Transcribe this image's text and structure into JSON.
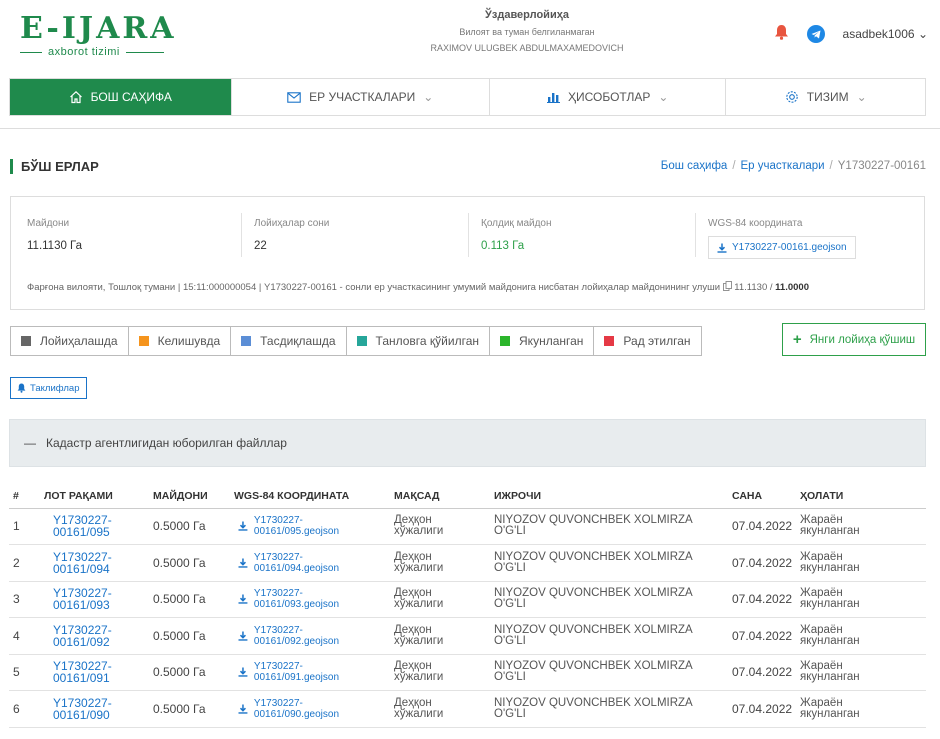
{
  "header": {
    "logo_main": "E-IJARA",
    "logo_sub": "axborot tizimi",
    "org_name": "Ўздаверлойиҳа",
    "org_region": "Вилоят ва туман белгиланмаган",
    "org_person": "RAXIMOV ULUGBEK ABDULMAXAMEDOVICH",
    "username": "asadbek1006"
  },
  "nav": {
    "items": [
      {
        "label": "БОШ САҲИФА",
        "icon": "home-icon"
      },
      {
        "label": "ЕР УЧАСТКАЛАРИ",
        "icon": "envelope-icon"
      },
      {
        "label": "ҲИСОБОТЛАР",
        "icon": "bar-chart-icon"
      },
      {
        "label": "ТИЗИМ",
        "icon": "gear-icon"
      }
    ]
  },
  "page": {
    "title": "БЎШ ЕРЛАР",
    "breadcrumb": [
      "Бош саҳифа",
      "Ер участкалари",
      "Y1730227-00161"
    ]
  },
  "info": {
    "area_label": "Майдони",
    "area_value": "11.1130 Га",
    "projects_label": "Лойиҳалар сони",
    "projects_value": "22",
    "remaining_label": "Қолдиқ майдон",
    "remaining_value": "0.113 Га",
    "coords_label": "WGS-84 координата",
    "coords_file": "Y1730227-00161.geojson",
    "footer_text": "Фарғона вилояти, Тошлоқ тумани | 15:11:000000054 | Y1730227-00161 - сонли ер участкасининг умумий майдонига нисбатан лойиҳалар майдонининг улуши",
    "footer_ratio": "11.1130 /",
    "footer_total": "11.0000"
  },
  "legend": [
    {
      "label": "Лойиҳалашда",
      "color": "#666666"
    },
    {
      "label": "Келишувда",
      "color": "#f5941d"
    },
    {
      "label": "Тасдиқлашда",
      "color": "#5b8ed6"
    },
    {
      "label": "Танловга қўйилган",
      "color": "#26a69a"
    },
    {
      "label": "Якунланган",
      "color": "#2bb52b"
    },
    {
      "label": "Рад этилган",
      "color": "#e53945"
    }
  ],
  "add_button": "Янги лойиҳа қўшиш",
  "suggestions_button": "Таклифлар",
  "panel_title": "Кадастр агентлигидан юборилган файллар",
  "table": {
    "headers": [
      "#",
      "ЛОТ РАҚАМИ",
      "МАЙДОНИ",
      "WGS-84 КООРДИНАТА",
      "МАҚСАД",
      "ИЖРОЧИ",
      "САНА",
      "ҲОЛАТИ"
    ],
    "rows": [
      {
        "n": "1",
        "lot": "Y1730227-00161/095",
        "area": "0.5000 Га",
        "geo": "Y1730227-00161/095.geojson",
        "purpose": "Деҳқон хўжалиги",
        "executor": "NIYOZOV QUVONCHBEK XOLMIRZA O'G'LI",
        "date": "07.04.2022",
        "status": "Жараён якунланган"
      },
      {
        "n": "2",
        "lot": "Y1730227-00161/094",
        "area": "0.5000 Га",
        "geo": "Y1730227-00161/094.geojson",
        "purpose": "Деҳқон хўжалиги",
        "executor": "NIYOZOV QUVONCHBEK XOLMIRZA O'G'LI",
        "date": "07.04.2022",
        "status": "Жараён якунланган"
      },
      {
        "n": "3",
        "lot": "Y1730227-00161/093",
        "area": "0.5000 Га",
        "geo": "Y1730227-00161/093.geojson",
        "purpose": "Деҳқон хўжалиги",
        "executor": "NIYOZOV QUVONCHBEK XOLMIRZA O'G'LI",
        "date": "07.04.2022",
        "status": "Жараён якунланган"
      },
      {
        "n": "4",
        "lot": "Y1730227-00161/092",
        "area": "0.5000 Га",
        "geo": "Y1730227-00161/092.geojson",
        "purpose": "Деҳқон хўжалиги",
        "executor": "NIYOZOV QUVONCHBEK XOLMIRZA O'G'LI",
        "date": "07.04.2022",
        "status": "Жараён якунланган"
      },
      {
        "n": "5",
        "lot": "Y1730227-00161/091",
        "area": "0.5000 Га",
        "geo": "Y1730227-00161/091.geojson",
        "purpose": "Деҳқон хўжалиги",
        "executor": "NIYOZOV QUVONCHBEK XOLMIRZA O'G'LI",
        "date": "07.04.2022",
        "status": "Жараён якунланган"
      },
      {
        "n": "6",
        "lot": "Y1730227-00161/090",
        "area": "0.5000 Га",
        "geo": "Y1730227-00161/090.geojson",
        "purpose": "Деҳқон хўжалиги",
        "executor": "NIYOZOV QUVONCHBEK XOLMIRZA O'G'LI",
        "date": "07.04.2022",
        "status": "Жараён якунланган"
      }
    ]
  }
}
